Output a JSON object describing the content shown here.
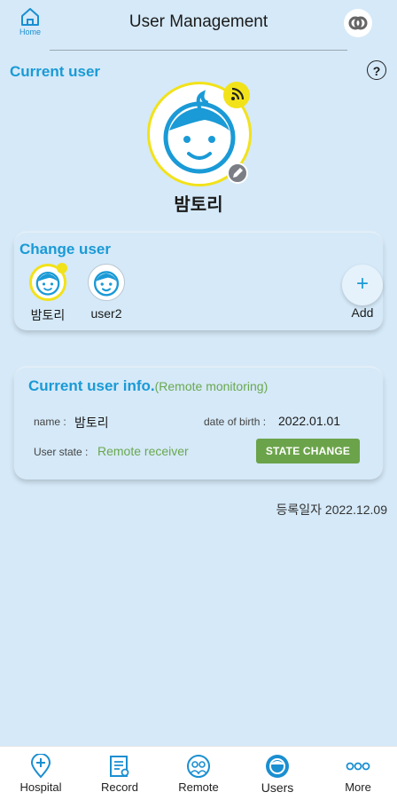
{
  "header": {
    "home_label": "Home",
    "title": "User Management"
  },
  "current_user": {
    "section_title": "Current user",
    "help_label": "?",
    "name": "밤토리"
  },
  "change_user": {
    "title": "Change user",
    "users": [
      {
        "name": "밤토리",
        "selected": true
      },
      {
        "name": "user2",
        "selected": false
      }
    ],
    "add_label": "Add",
    "add_symbol": "+"
  },
  "user_info": {
    "title": "Current user info.",
    "subtitle": "(Remote monitoring)",
    "name_label": "name :",
    "name_value": "밤토리",
    "dob_label": "date of birth :",
    "dob_value": "2022.01.01",
    "state_label": "User state :",
    "state_value": "Remote receiver",
    "state_button": "STATE CHANGE"
  },
  "registration": "등록일자 2022.12.09",
  "nav": {
    "items": [
      {
        "label": "Hospital",
        "icon": "hospital-pin-icon"
      },
      {
        "label": "Record",
        "icon": "record-icon"
      },
      {
        "label": "Remote",
        "icon": "remote-icon"
      },
      {
        "label": "Users",
        "icon": "users-icon",
        "active": true
      },
      {
        "label": "More",
        "icon": "more-icon"
      }
    ]
  },
  "colors": {
    "accent": "#1a9ad6",
    "background": "#d5e9f8",
    "highlight": "#f2e21a",
    "state_green": "#6ba34a"
  }
}
